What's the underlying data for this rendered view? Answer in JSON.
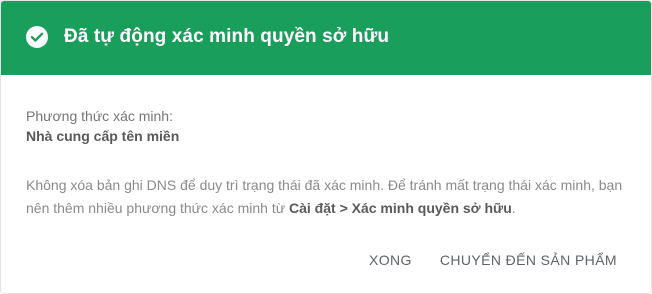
{
  "dialog": {
    "title": "Đã tự động xác minh quyền sở hữu",
    "header_color": "#1a9e5c",
    "icon": "check-circle-icon",
    "method_label": "Phương thức xác minh:",
    "method_value": "Nhà cung cấp tên miền",
    "note_text": "Không xóa bản ghi DNS để duy trì trạng thái đã xác minh. Để tránh mất trạng thái xác minh, bạn nên thêm nhiều phương thức xác minh từ ",
    "note_link": "Cài đặt > Xác minh quyền sở hữu",
    "note_end": ".",
    "buttons": {
      "done": "XONG",
      "go_to_product": "CHUYỂN ĐẾN SẢN PHẨM"
    }
  }
}
